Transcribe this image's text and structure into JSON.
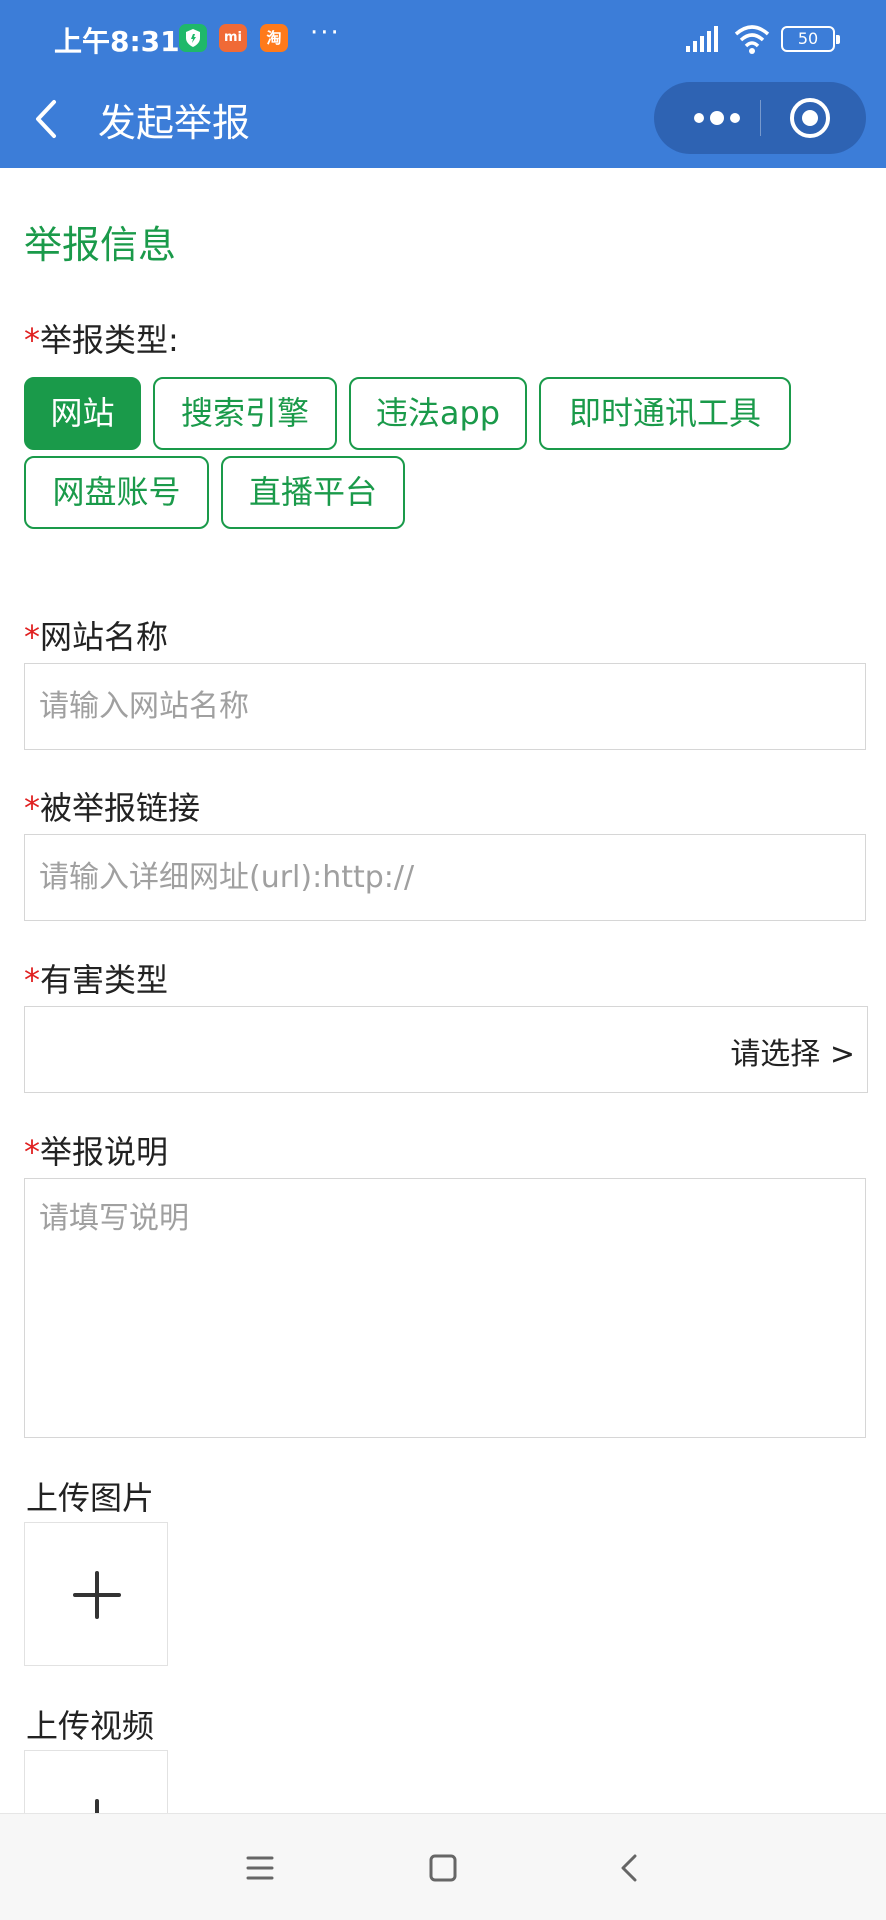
{
  "status_bar": {
    "time": "上午8:31",
    "badges": [
      "shield-app-icon",
      "mi-app-icon",
      "taobao-app-icon"
    ],
    "badge_mi_text": "mi",
    "badge_tao_text": "淘",
    "more": "···",
    "battery": "50"
  },
  "nav": {
    "title": "发起举报"
  },
  "form": {
    "section_title": "举报信息",
    "report_type": {
      "required_mark": "*",
      "label": "举报类型:",
      "options": [
        "网站",
        "搜索引擎",
        "违法app",
        "即时通讯工具",
        "网盘账号",
        "直播平台"
      ],
      "selected": "网站"
    },
    "site_name": {
      "required_mark": "*",
      "label": "网站名称",
      "placeholder": "请输入网站名称",
      "value": ""
    },
    "reported_link": {
      "required_mark": "*",
      "label": "被举报链接",
      "placeholder": "请输入详细网址(url):http://",
      "value": ""
    },
    "harm_type": {
      "required_mark": "*",
      "label": "有害类型",
      "select_text": "请选择 >"
    },
    "description": {
      "required_mark": "*",
      "label": "举报说明",
      "placeholder": "请填写说明"
    },
    "upload_image": {
      "label": "上传图片"
    },
    "upload_video": {
      "label": "上传视频"
    }
  },
  "colors": {
    "header": "#3c7dd8",
    "accent_green": "#1a9a4a",
    "required_red": "#e02020"
  }
}
